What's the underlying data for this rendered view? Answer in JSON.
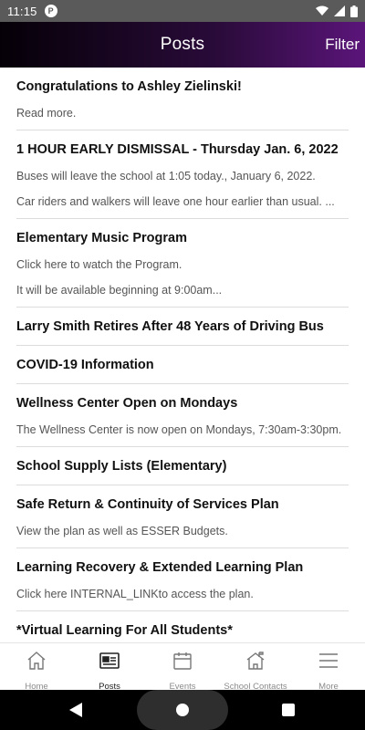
{
  "status": {
    "time": "11:15",
    "notification_glyph": "P"
  },
  "header": {
    "title": "Posts",
    "filter_label": "Filter"
  },
  "posts": [
    {
      "title": "Congratulations to Ashley Zielinski!",
      "lines": [
        "Read more."
      ]
    },
    {
      "title": "1 HOUR EARLY DISMISSAL - Thursday Jan. 6, 2022",
      "lines": [
        "Buses will leave the school at 1:05 today., January 6, 2022.",
        "Car riders and walkers  will leave one hour earlier than usual. ..."
      ]
    },
    {
      "title": "Elementary Music Program",
      "lines": [
        "Click here to watch the Program.",
        "It will be available beginning at 9:00am..."
      ]
    },
    {
      "title": "Larry Smith Retires After 48 Years of Driving Bus",
      "lines": []
    },
    {
      "title": "COVID-19 Information",
      "lines": []
    },
    {
      "title": "Wellness Center Open on Mondays",
      "lines": [
        "The Wellness Center is now open on Mondays, 7:30am-3:30pm."
      ]
    },
    {
      "title": "School Supply Lists (Elementary)",
      "lines": []
    },
    {
      "title": "Safe Return & Continuity of Services Plan",
      "lines": [
        "View the plan as well as ESSER Budgets."
      ]
    },
    {
      "title": "Learning Recovery & Extended Learning Plan",
      "lines": [
        "Click here  INTERNAL_LINKto access the plan."
      ]
    },
    {
      "title": "*Virtual Learning For All Students*",
      "lines": []
    }
  ],
  "bottom_nav": [
    {
      "label": "Home",
      "icon": "home-icon",
      "active": false
    },
    {
      "label": "Posts",
      "icon": "posts-icon",
      "active": true
    },
    {
      "label": "Events",
      "icon": "calendar-icon",
      "active": false
    },
    {
      "label": "School Contacts",
      "icon": "school-icon",
      "active": false
    },
    {
      "label": "More",
      "icon": "menu-icon",
      "active": false
    }
  ],
  "colors": {
    "header_start": "#050007",
    "header_end": "#5b157a",
    "divider": "#dcdcdc"
  }
}
